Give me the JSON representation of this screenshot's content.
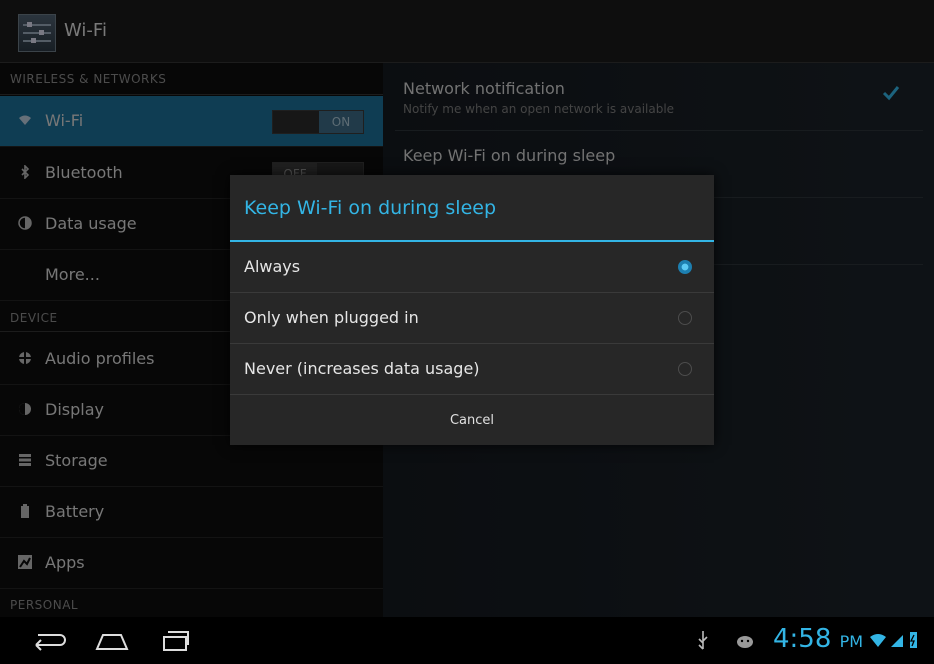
{
  "actionbar": {
    "title": "Wi-Fi"
  },
  "sidebar": {
    "categories": [
      "WIRELESS & NETWORKS",
      "DEVICE",
      "PERSONAL"
    ],
    "items": [
      {
        "label": "Wi-Fi",
        "icon": "wifi-icon",
        "toggle": "ON"
      },
      {
        "label": "Bluetooth",
        "icon": "bluetooth-icon",
        "toggle": "OFF"
      },
      {
        "label": "Data usage",
        "icon": "data-usage-icon"
      },
      {
        "label": "More..."
      },
      {
        "label": "Audio profiles",
        "icon": "audio-profiles-icon"
      },
      {
        "label": "Display",
        "icon": "display-icon"
      },
      {
        "label": "Storage",
        "icon": "storage-icon"
      },
      {
        "label": "Battery",
        "icon": "battery-icon"
      },
      {
        "label": "Apps",
        "icon": "apps-icon"
      }
    ]
  },
  "prefs": [
    {
      "title": "Network notification",
      "summary": "Notify me when an open network is available",
      "checked": true
    },
    {
      "title": "Keep Wi-Fi on during sleep"
    }
  ],
  "dialog": {
    "title": "Keep Wi-Fi on during sleep",
    "options": [
      "Always",
      "Only when plugged in",
      "Never (increases data usage)"
    ],
    "selected": "Always",
    "cancel": "Cancel"
  },
  "statusbar": {
    "time": "4:58",
    "ampm": "PM"
  },
  "colors": {
    "accent": "#33b5e5",
    "selected_row": "#1d6f98"
  }
}
